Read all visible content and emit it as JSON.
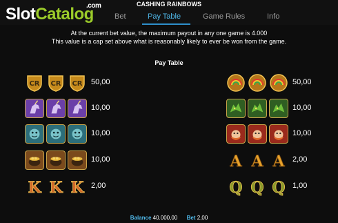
{
  "watermark": {
    "slot": "Slot",
    "catalog": "Catalog",
    "com": ".com"
  },
  "game_title": "CASHING RAINBOWS",
  "tabs": [
    {
      "label": "Bet",
      "active": false
    },
    {
      "label": "Pay Table",
      "active": true
    },
    {
      "label": "Game Rules",
      "active": false
    },
    {
      "label": "Info",
      "active": false
    }
  ],
  "notice": {
    "line1": "At the current bet value, the maximum payout in any one game is 4.000",
    "line2": "This value is a cap set above what is reasonably likely to ever be won from the game."
  },
  "pay_table": {
    "title": "Pay Table",
    "left": [
      {
        "symbol": "gold-shield-icon",
        "value": "50,00"
      },
      {
        "symbol": "purple-unicorn-icon",
        "value": "10,00"
      },
      {
        "symbol": "teal-troll-icon",
        "value": "10,00"
      },
      {
        "symbol": "pot-of-gold-icon",
        "value": "10,00"
      },
      {
        "symbol": "letter-k-icon",
        "value": "2,00"
      }
    ],
    "right": [
      {
        "symbol": "rainbow-coin-icon",
        "value": "50,00"
      },
      {
        "symbol": "green-dragon-icon",
        "value": "10,00"
      },
      {
        "symbol": "red-leprechaun-icon",
        "value": "10,00"
      },
      {
        "symbol": "letter-a-icon",
        "value": "2,00"
      },
      {
        "symbol": "letter-q-icon",
        "value": "1,00"
      }
    ]
  },
  "footer": {
    "balance_label": "Balance",
    "balance_value": "40.000,00",
    "bet_label": "Bet",
    "bet_value": "2,00"
  },
  "colors": {
    "accent": "#4fb7e8",
    "logo_green": "#9ccc2a",
    "background": "#0d0d0d"
  }
}
